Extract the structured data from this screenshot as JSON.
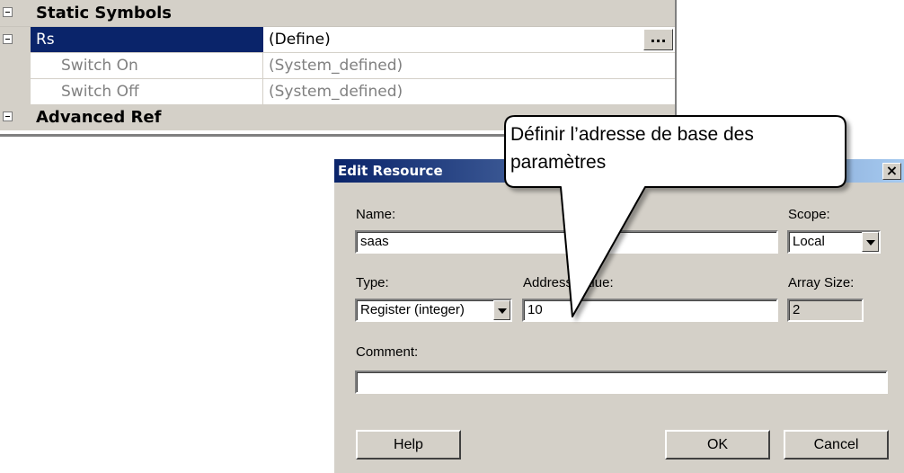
{
  "property_grid": {
    "category": "Static Symbols",
    "rs_row": {
      "name": "Rs",
      "value": "(Define)",
      "button": "..."
    },
    "switch_on": {
      "name": "Switch On",
      "value": "(System_defined)"
    },
    "switch_off": {
      "name": "Switch Off",
      "value": "(System_defined)"
    },
    "next_category": "Advanced Ref"
  },
  "dialog": {
    "title": "Edit Resource",
    "close": "×",
    "name_label": "Name:",
    "name_value": "saas",
    "scope_label": "Scope:",
    "scope_value": "Local",
    "type_label": "Type:",
    "type_value": "Register (integer)",
    "address_label": "Address/Value:",
    "address_value": "10",
    "array_label": "Array Size:",
    "array_value": "2",
    "comment_label": "Comment:",
    "comment_value": "",
    "help_button": "Help",
    "ok_button": "OK",
    "cancel_button": "Cancel"
  },
  "callout": {
    "line1": "Définir l’adresse de base des",
    "line2": "paramètres"
  },
  "colors": {
    "selection": "#0a246a",
    "face": "#d4d0c8",
    "title_gradient_end": "#a6caf0"
  }
}
